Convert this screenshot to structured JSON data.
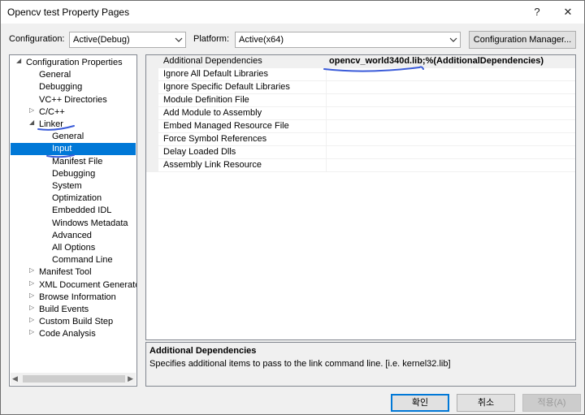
{
  "window": {
    "title": "Opencv test Property Pages",
    "help_label": "?",
    "close_label": "✕"
  },
  "toolbar": {
    "configuration_label": "Configuration:",
    "configuration_value": "Active(Debug)",
    "platform_label": "Platform:",
    "platform_value": "Active(x64)",
    "config_manager_label": "Configuration Manager..."
  },
  "tree": {
    "items": [
      {
        "label": "Configuration Properties",
        "expander": "◢"
      },
      {
        "label": "General"
      },
      {
        "label": "Debugging"
      },
      {
        "label": "VC++ Directories"
      },
      {
        "label": "C/C++",
        "expander": "▷"
      },
      {
        "label": "Linker",
        "expander": "◢"
      },
      {
        "label": "General"
      },
      {
        "label": "Input",
        "selected": true
      },
      {
        "label": "Manifest File"
      },
      {
        "label": "Debugging"
      },
      {
        "label": "System"
      },
      {
        "label": "Optimization"
      },
      {
        "label": "Embedded IDL"
      },
      {
        "label": "Windows Metadata"
      },
      {
        "label": "Advanced"
      },
      {
        "label": "All Options"
      },
      {
        "label": "Command Line"
      },
      {
        "label": "Manifest Tool",
        "expander": "▷"
      },
      {
        "label": "XML Document Generator",
        "expander": "▷"
      },
      {
        "label": "Browse Information",
        "expander": "▷"
      },
      {
        "label": "Build Events",
        "expander": "▷"
      },
      {
        "label": "Custom Build Step",
        "expander": "▷"
      },
      {
        "label": "Code Analysis",
        "expander": "▷"
      }
    ],
    "scroll_left": "◀",
    "scroll_right": "▶"
  },
  "properties": [
    {
      "name": "Additional Dependencies",
      "value": "opencv_world340d.lib;%(AdditionalDependencies)"
    },
    {
      "name": "Ignore All Default Libraries",
      "value": ""
    },
    {
      "name": "Ignore Specific Default Libraries",
      "value": ""
    },
    {
      "name": "Module Definition File",
      "value": ""
    },
    {
      "name": "Add Module to Assembly",
      "value": ""
    },
    {
      "name": "Embed Managed Resource File",
      "value": ""
    },
    {
      "name": "Force Symbol References",
      "value": ""
    },
    {
      "name": "Delay Loaded Dlls",
      "value": ""
    },
    {
      "name": "Assembly Link Resource",
      "value": ""
    }
  ],
  "description": {
    "heading": "Additional Dependencies",
    "text": "Specifies additional items to pass to the link command line. [i.e. kernel32.lib]"
  },
  "buttons": {
    "ok": "확인",
    "cancel": "취소",
    "apply": "적용(A)"
  },
  "colors": {
    "selection": "#0078d7",
    "annotation_pen": "#3a5bd9"
  }
}
